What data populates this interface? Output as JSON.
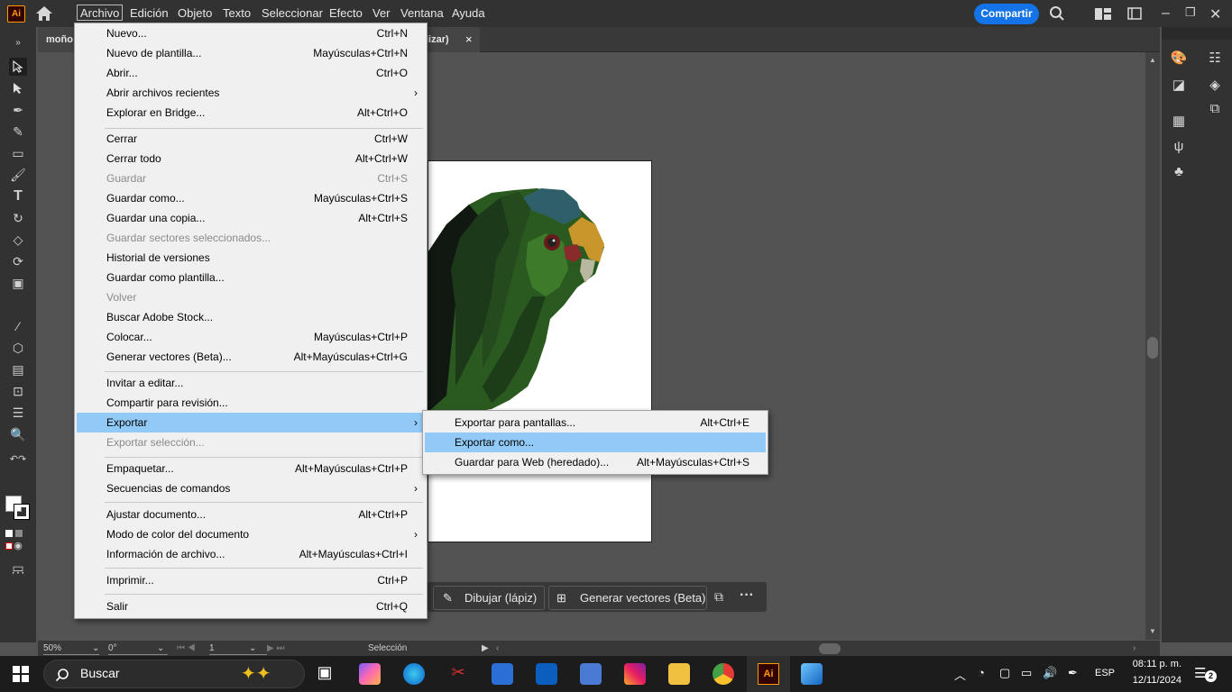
{
  "app": {
    "logo": "Ai"
  },
  "menubar": {
    "items": [
      "Archivo",
      "Edición",
      "Objeto",
      "Texto",
      "Seleccionar",
      "Efecto",
      "Ver",
      "Ventana",
      "Ayuda"
    ],
    "share": "Compartir"
  },
  "tabs": {
    "doc_left": "moño",
    "doc_right": "lizar)",
    "close": "×"
  },
  "file_menu": {
    "items": [
      {
        "label": "Nuevo...",
        "shortcut": "Ctrl+N"
      },
      {
        "label": "Nuevo de plantilla...",
        "shortcut": "Mayúsculas+Ctrl+N"
      },
      {
        "label": "Abrir...",
        "shortcut": "Ctrl+O"
      },
      {
        "label": "Abrir archivos recientes",
        "shortcut": ""
      },
      {
        "label": "Explorar en Bridge...",
        "shortcut": "Alt+Ctrl+O"
      },
      {
        "label": "Cerrar",
        "shortcut": "Ctrl+W"
      },
      {
        "label": "Cerrar todo",
        "shortcut": "Alt+Ctrl+W"
      },
      {
        "label": "Guardar",
        "shortcut": "Ctrl+S"
      },
      {
        "label": "Guardar como...",
        "shortcut": "Mayúsculas+Ctrl+S"
      },
      {
        "label": "Guardar una copia...",
        "shortcut": "Alt+Ctrl+S"
      },
      {
        "label": "Guardar sectores seleccionados...",
        "shortcut": ""
      },
      {
        "label": "Historial de versiones",
        "shortcut": ""
      },
      {
        "label": "Guardar como plantilla...",
        "shortcut": ""
      },
      {
        "label": "Volver",
        "shortcut": ""
      },
      {
        "label": "Buscar Adobe Stock...",
        "shortcut": ""
      },
      {
        "label": "Colocar...",
        "shortcut": "Mayúsculas+Ctrl+P"
      },
      {
        "label": "Generar vectores (Beta)...",
        "shortcut": "Alt+Mayúsculas+Ctrl+G"
      },
      {
        "label": "Invitar a editar...",
        "shortcut": ""
      },
      {
        "label": "Compartir para revisión...",
        "shortcut": ""
      },
      {
        "label": "Exportar",
        "shortcut": ""
      },
      {
        "label": "Exportar selección...",
        "shortcut": ""
      },
      {
        "label": "Empaquetar...",
        "shortcut": "Alt+Mayúsculas+Ctrl+P"
      },
      {
        "label": "Secuencias de comandos",
        "shortcut": ""
      },
      {
        "label": "Ajustar documento...",
        "shortcut": "Alt+Ctrl+P"
      },
      {
        "label": "Modo de color del documento",
        "shortcut": ""
      },
      {
        "label": "Información de archivo...",
        "shortcut": "Alt+Mayúsculas+Ctrl+I"
      },
      {
        "label": "Imprimir...",
        "shortcut": "Ctrl+P"
      },
      {
        "label": "Salir",
        "shortcut": "Ctrl+Q"
      }
    ]
  },
  "export_submenu": {
    "items": [
      {
        "label": "Exportar para pantallas...",
        "shortcut": "Alt+Ctrl+E"
      },
      {
        "label": "Exportar como...",
        "shortcut": ""
      },
      {
        "label": "Guardar para Web (heredado)...",
        "shortcut": "Alt+Mayúsculas+Ctrl+S"
      }
    ]
  },
  "context_bar": {
    "draw": "Dibujar (lápiz)",
    "generate": "Generar vectores (Beta)"
  },
  "statusbar": {
    "zoom": "50%",
    "rotation": "0°",
    "artboard": "1",
    "tool": "Selección"
  },
  "taskbar": {
    "search": "Buscar",
    "lang": "ESP",
    "time": "08:11 p. m.",
    "date": "12/11/2024",
    "notif": "2"
  },
  "colors": {
    "accent": "#1473e6",
    "highlight": "#91c9f7",
    "ai_orange": "#ff9a00"
  }
}
